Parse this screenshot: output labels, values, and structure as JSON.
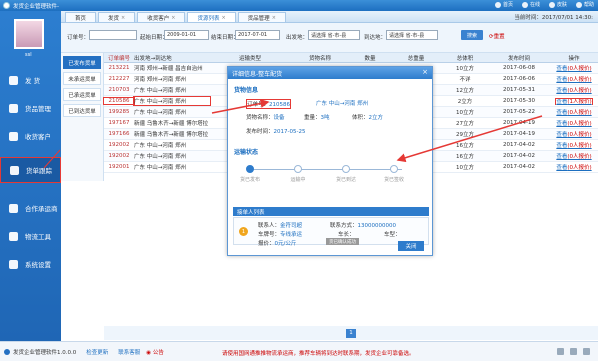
{
  "app": {
    "title": "发货企业管理软件-"
  },
  "topbar": {
    "items": [
      "首页",
      "在线",
      "皮肤",
      "帮助"
    ]
  },
  "user": {
    "name": "ssl"
  },
  "sidebar": {
    "items": [
      {
        "label": "发 货",
        "icon": "truck-icon"
      },
      {
        "label": "货品管理",
        "icon": "box-icon"
      },
      {
        "label": "收货客户",
        "icon": "customer-icon"
      },
      {
        "label": "货单跟踪",
        "icon": "tracking-icon"
      },
      {
        "label": "合作承运商",
        "icon": "partner-icon"
      },
      {
        "label": "物流工具",
        "icon": "tools-icon"
      },
      {
        "label": "系统设置",
        "icon": "settings-icon"
      }
    ]
  },
  "tabs": [
    {
      "label": "首页"
    },
    {
      "label": "发货"
    },
    {
      "label": "收货客户"
    },
    {
      "label": "货源列表"
    },
    {
      "label": "货品管理"
    }
  ],
  "current_time": "当前时间：2017/07/01   14:30:",
  "filter": {
    "order_label": "订单号：",
    "order_value": "",
    "start_label": "起始日期：",
    "start_value": "2009-01-01",
    "end_label": "结束日期：",
    "end_value": "2017-07-01",
    "from_label": "出发地：",
    "from_value": "请选择 省-市-县",
    "to_label": "到达地：",
    "to_value": "请选择 省-市-县",
    "search": "搜索",
    "reset": "重置"
  },
  "status_buttons": [
    "已发布货单",
    "未承运货单",
    "已承运货单",
    "已到达货单"
  ],
  "columns": [
    "订单编号",
    "出发地→到达地",
    "运输类型",
    "货物名称",
    "数量",
    "总重量",
    "总体积",
    "发布时间",
    "操作"
  ],
  "rows": [
    {
      "id": "213221",
      "route": "河南 郑州→新疆 昌吉自治州",
      "vol": "10立方",
      "date": "2017-06-08"
    },
    {
      "id": "212227",
      "route": "河南 郑州→河南 郑州",
      "vol": "不详",
      "date": "2017-06-06"
    },
    {
      "id": "210703",
      "route": "广东 中山→河南 郑州",
      "vol": "12立方",
      "date": "2017-05-31"
    },
    {
      "id": "210586",
      "route": "广东 中山→河南 郑州",
      "vol": "2立方",
      "date": "2017-05-30"
    },
    {
      "id": "199285",
      "route": "广东 中山→河南 郑州",
      "vol": "10立方",
      "date": "2017-05-22"
    },
    {
      "id": "197167",
      "route": "新疆 乌鲁木齐→新疆 博尔塔拉",
      "vol": "27立方",
      "date": "2017-04-19"
    },
    {
      "id": "197166",
      "route": "新疆 乌鲁木齐→新疆 博尔塔拉",
      "vol": "29立方",
      "date": "2017-04-19"
    },
    {
      "id": "192002",
      "route": "广东 中山→河南 郑州",
      "vol": "16立方",
      "date": "2017-04-02"
    },
    {
      "id": "192002",
      "route": "广东 中山→河南 郑州",
      "vol": "16立方",
      "date": "2017-04-02"
    },
    {
      "id": "192001",
      "route": "广东 中山→河南 郑州",
      "vol": "10立方",
      "date": "2017-04-02"
    }
  ],
  "row_ops": [
    "查看",
    "(0人报价)",
    "(1人报价)"
  ],
  "modal": {
    "title": "详细信息-整车配货",
    "section_goods": "货物信息",
    "order_label": "订单号：",
    "order_value": "210586",
    "route_value": "广东 中山→河南 郑州",
    "goods_label": "货物名称：",
    "goods_value": "设备",
    "weight_label": "重量：",
    "weight_value": "3吨",
    "vol_label": "体积：",
    "vol_value": "2立方",
    "pub_label": "发布时间：",
    "pub_value": "2017-05-25",
    "section_status": "运输状态",
    "status_steps": [
      "货已发布",
      "运输中",
      "货已到达",
      "货已签收"
    ],
    "carriers_title": "接单人列表",
    "carrier_no": "1",
    "contact_label": "联系人：",
    "contact_value": "金符司超",
    "phone_label": "联系方式：",
    "phone_value": "13000000000",
    "plate_label": "车牌号：",
    "plate_value": "专线承运",
    "car_len_label": "车长：",
    "car_len_value": "",
    "car_type_label": "车型：",
    "car_type_value": "",
    "price_label": "报价：",
    "price_value": "0元/公斤",
    "accept_btn": "货已确认成功",
    "close_btn": "关闭"
  },
  "pager": {
    "page": "1"
  },
  "bottom": {
    "version": "发货企业管理软件1.0.0.0",
    "links": [
      "检查更新",
      "联系客服"
    ],
    "notice": "公告",
    "marquee": "请使用国网通推推物流承运商，推荐车辆将到达时联系期，发货企业可靠备选。"
  },
  "colors": {
    "accent": "#1d6fc0",
    "highlight": "#e53935"
  }
}
